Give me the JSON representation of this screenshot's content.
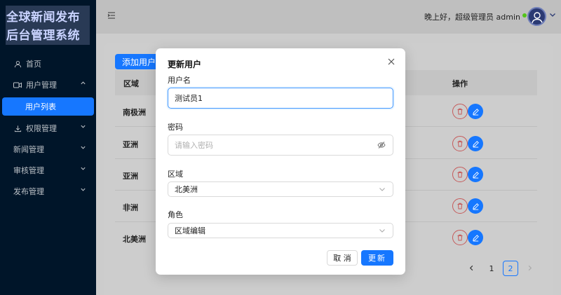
{
  "app": {
    "logo_line1": "全球新闻发布",
    "logo_line2": "后台管理系统"
  },
  "sidebar": {
    "items": [
      {
        "label": "首页",
        "icon": "user-icon"
      },
      {
        "label": "用户管理",
        "icon": "video-icon",
        "expanded": true
      },
      {
        "label": "用户列表",
        "active": true
      },
      {
        "label": "权限管理",
        "icon": "download-icon"
      },
      {
        "label": "新闻管理"
      },
      {
        "label": "审核管理"
      },
      {
        "label": "发布管理"
      }
    ]
  },
  "header": {
    "greeting": "晚上好，超级管理员 admin",
    "status_color": "#52c41a"
  },
  "toolbar": {
    "add_user_label": "添加用户"
  },
  "table": {
    "columns": [
      "区域",
      "操作"
    ],
    "rows": [
      {
        "region": "南极洲"
      },
      {
        "region": "亚洲"
      },
      {
        "region": "亚洲"
      },
      {
        "region": "非洲"
      },
      {
        "region": "北美洲"
      }
    ]
  },
  "pagination": {
    "pages": [
      "1",
      "2"
    ],
    "current": "2"
  },
  "modal": {
    "title": "更新用户",
    "username_label": "用户名",
    "username_value": "测试员1",
    "password_label": "密码",
    "password_placeholder": "请输入密码",
    "region_label": "区域",
    "region_value": "北美洲",
    "role_label": "角色",
    "role_value": "区域编辑",
    "cancel_label": "取 消",
    "ok_label": "更新"
  },
  "colors": {
    "primary": "#1677ff",
    "sidebar_bg": "#001529",
    "danger": "#c55a5a"
  }
}
